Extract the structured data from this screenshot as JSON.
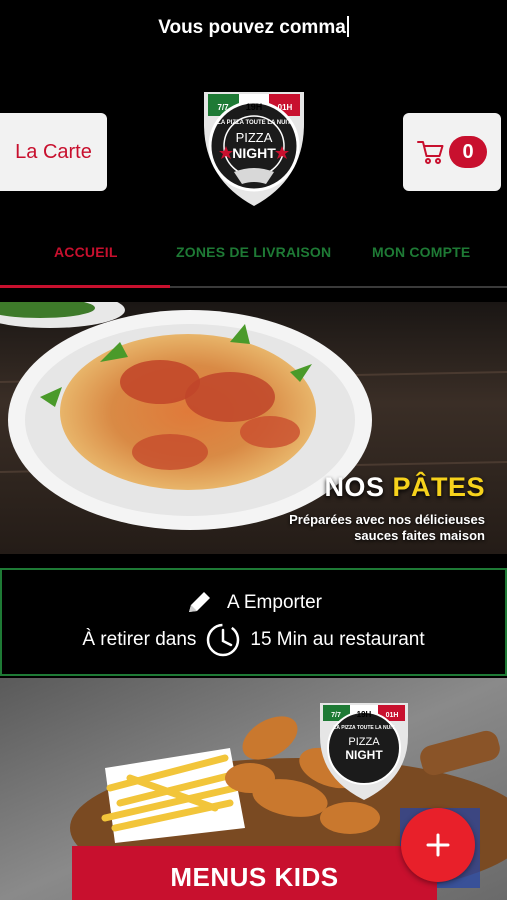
{
  "ticker": {
    "text": "Vous pouvez comma"
  },
  "header": {
    "menu_button": "La Carte",
    "cart_count": "0",
    "logo_text": {
      "top": "19H",
      "left": "7/7",
      "right": "01H",
      "ring": "LA PIZZA TOUTE LA NUIT",
      "line1": "PIZZA",
      "line2": "NIGHT"
    }
  },
  "tabs": [
    {
      "label": "ACCUEIL",
      "active": true
    },
    {
      "label": "ZONES DE LIVRAISON",
      "active": false
    },
    {
      "label": "MON COMPTE",
      "active": false
    }
  ],
  "banner": {
    "title_part1": "NOS",
    "title_part2": "PÂTES",
    "subtitle_line1": "Préparées avec nos délicieuses",
    "subtitle_line2": "sauces faites maison"
  },
  "order_info": {
    "mode": "A Emporter",
    "pickup_prefix": "À retirer dans",
    "pickup_suffix": "15 Min au restaurant"
  },
  "kids_card": {
    "button": "MENUS KIDS",
    "logo_text": {
      "top": "19H",
      "left": "7/7",
      "right": "01H",
      "ring": "LA PIZZA TOUTE LA NUIT",
      "line1": "PIZZA",
      "line2": "NIGHT"
    }
  },
  "fab": {
    "icon": "plus-icon"
  },
  "colors": {
    "brand_red": "#c8102e",
    "brand_green": "#1e7a35",
    "accent_yellow": "#f6d21c"
  }
}
